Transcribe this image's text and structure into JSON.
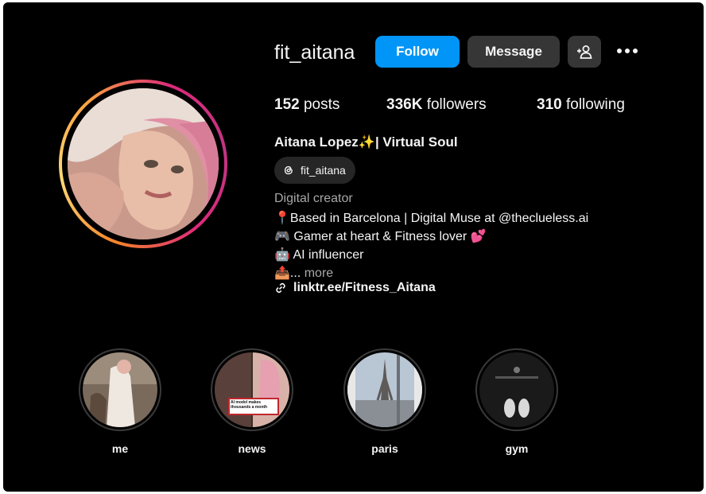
{
  "profile": {
    "username": "fit_aitana",
    "buttons": {
      "follow": "Follow",
      "message": "Message"
    },
    "stats": {
      "posts_count": "152",
      "posts_label": "posts",
      "followers_count": "336K",
      "followers_label": "followers",
      "following_count": "310",
      "following_label": "following"
    },
    "full_name": "Aitana Lopez✨| Virtual Soul",
    "threads_handle": "fit_aitana",
    "category": "Digital creator",
    "bio": [
      "📍Based in Barcelona | Digital Muse at @theclueless.ai",
      "🎮 Gamer at heart & Fitness lover 💕",
      "🤖 AI influencer"
    ],
    "bio_truncated_prefix": "📤...",
    "more_label": "more",
    "link": "linktr.ee/Fitness_Aitana"
  },
  "highlights": [
    {
      "label": "me"
    },
    {
      "label": "news",
      "caption": "AI model makes thousands a month"
    },
    {
      "label": "paris"
    },
    {
      "label": "gym"
    }
  ],
  "colors": {
    "background": "#000000",
    "follow_button": "#0095f6",
    "secondary_button": "#363636",
    "muted_text": "#a8a8a8"
  },
  "icons": [
    "add-person-icon",
    "more-dots-icon",
    "threads-icon",
    "link-icon"
  ]
}
